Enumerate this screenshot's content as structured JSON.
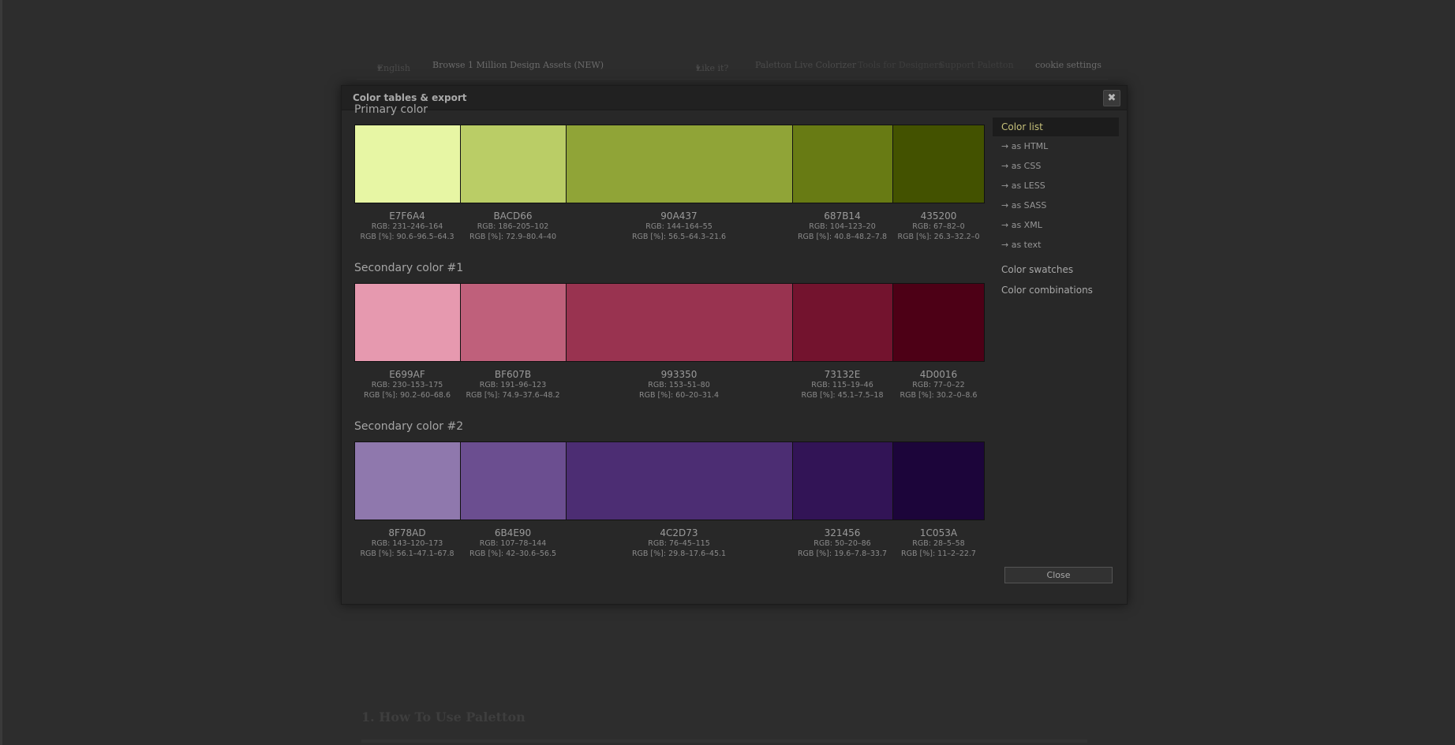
{
  "background": {
    "nav": {
      "language": "English",
      "language_arrow": "▾",
      "browse": "Browse 1 Million Design Assets (NEW)",
      "like": "Like it?",
      "like_arrow": "▾",
      "palette_live": "Paletton Live Colorizer",
      "dim_link_1": "Tools for Designers",
      "dim_link_2": "Support Paletton",
      "cookie": "cookie settings"
    },
    "heading": "1. How To Use Paletton"
  },
  "modal": {
    "title": "Color tables & export",
    "close_glyph": "✖",
    "close_button": "Close"
  },
  "sidebar": {
    "color_list": "Color list",
    "exports": [
      "→ as HTML",
      "→ as CSS",
      "→ as LESS",
      "→ as SASS",
      "→ as XML",
      "→ as text"
    ],
    "color_swatches": "Color swatches",
    "color_combinations": "Color combinations"
  },
  "sections": [
    {
      "title": "Primary color",
      "colors": [
        {
          "hex": "E7F6A4",
          "color": "#E7F6A4",
          "rgb": "RGB: 231–246–164",
          "rgb_pct": "RGB [%]: 90.6–96.5–64.3"
        },
        {
          "hex": "BACD66",
          "color": "#BACD66",
          "rgb": "RGB: 186–205–102",
          "rgb_pct": "RGB [%]: 72.9–80.4–40"
        },
        {
          "hex": "90A437",
          "color": "#90A437",
          "rgb": "RGB: 144–164–55",
          "rgb_pct": "RGB [%]: 56.5–64.3–21.6"
        },
        {
          "hex": "687B14",
          "color": "#687B14",
          "rgb": "RGB: 104–123–20",
          "rgb_pct": "RGB [%]: 40.8–48.2–7.8"
        },
        {
          "hex": "435200",
          "color": "#435200",
          "rgb": "RGB: 67–82–0",
          "rgb_pct": "RGB [%]: 26.3–32.2–0"
        }
      ]
    },
    {
      "title": "Secondary color #1",
      "colors": [
        {
          "hex": "E699AF",
          "color": "#E699AF",
          "rgb": "RGB: 230–153–175",
          "rgb_pct": "RGB [%]: 90.2–60–68.6"
        },
        {
          "hex": "BF607B",
          "color": "#BF607B",
          "rgb": "RGB: 191–96–123",
          "rgb_pct": "RGB [%]: 74.9–37.6–48.2"
        },
        {
          "hex": "993350",
          "color": "#993350",
          "rgb": "RGB: 153–51–80",
          "rgb_pct": "RGB [%]: 60–20–31.4"
        },
        {
          "hex": "73132E",
          "color": "#73132E",
          "rgb": "RGB: 115–19–46",
          "rgb_pct": "RGB [%]: 45.1–7.5–18"
        },
        {
          "hex": "4D0016",
          "color": "#4D0016",
          "rgb": "RGB: 77–0–22",
          "rgb_pct": "RGB [%]: 30.2–0–8.6"
        }
      ]
    },
    {
      "title": "Secondary color #2",
      "colors": [
        {
          "hex": "8F78AD",
          "color": "#8F78AD",
          "rgb": "RGB: 143–120–173",
          "rgb_pct": "RGB [%]: 56.1–47.1–67.8"
        },
        {
          "hex": "6B4E90",
          "color": "#6B4E90",
          "rgb": "RGB: 107–78–144",
          "rgb_pct": "RGB [%]: 42–30.6–56.5"
        },
        {
          "hex": "4C2D73",
          "color": "#4C2D73",
          "rgb": "RGB: 76–45–115",
          "rgb_pct": "RGB [%]: 29.8–17.6–45.1"
        },
        {
          "hex": "321456",
          "color": "#321456",
          "rgb": "RGB: 50–20–86",
          "rgb_pct": "RGB [%]: 19.6–7.8–33.7"
        },
        {
          "hex": "1C053A",
          "color": "#1C053A",
          "rgb": "RGB: 28–5–58",
          "rgb_pct": "RGB [%]: 11–2–22.7"
        }
      ]
    }
  ]
}
